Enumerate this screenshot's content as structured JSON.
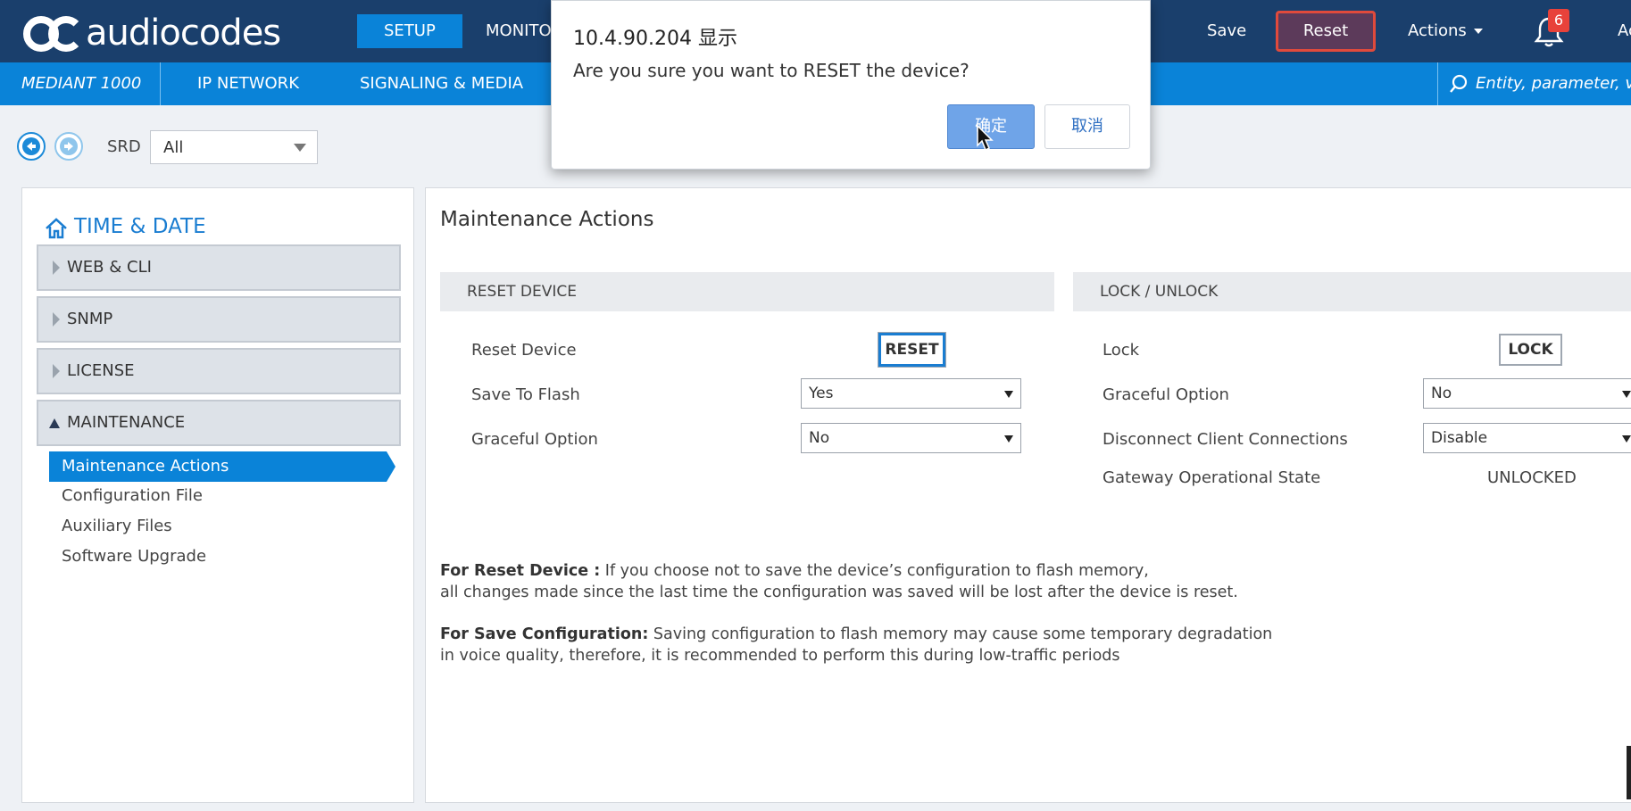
{
  "header": {
    "logo_text": "audiocodes",
    "tabs": [
      {
        "label": "SETUP",
        "active": true
      },
      {
        "label": "MONITOR",
        "active": false
      }
    ],
    "save_label": "Save",
    "reset_label": "Reset",
    "actions_label": "Actions",
    "notification_count": "6",
    "overflow_label": "Ac",
    "colors": {
      "bar": "#1a3f6c",
      "accent": "#0a83d8",
      "reset_bg": "#5c3a5a",
      "reset_border": "#e04a3c",
      "badge": "#e8423a"
    }
  },
  "subnav": {
    "device": "MEDIANT 1000",
    "items": [
      "IP NETWORK",
      "SIGNALING & MEDIA"
    ],
    "search_placeholder": "Entity, parameter, value"
  },
  "srd": {
    "label": "SRD",
    "value": "All"
  },
  "sidebar": {
    "title": "TIME & DATE",
    "sections": [
      {
        "label": "WEB & CLI",
        "expanded": false
      },
      {
        "label": "SNMP",
        "expanded": false
      },
      {
        "label": "LICENSE",
        "expanded": false
      },
      {
        "label": "MAINTENANCE",
        "expanded": true
      }
    ],
    "items": [
      {
        "label": "Maintenance Actions",
        "active": true
      },
      {
        "label": "Configuration File",
        "active": false
      },
      {
        "label": "Auxiliary Files",
        "active": false
      },
      {
        "label": "Software Upgrade",
        "active": false
      }
    ]
  },
  "main": {
    "title": "Maintenance Actions",
    "reset_section": {
      "header": "RESET DEVICE",
      "reset_device_label": "Reset Device",
      "reset_button": "RESET",
      "save_to_flash_label": "Save To Flash",
      "save_to_flash_value": "Yes",
      "graceful_label": "Graceful Option",
      "graceful_value": "No"
    },
    "lock_section": {
      "header": "LOCK / UNLOCK",
      "lock_label": "Lock",
      "lock_button": "LOCK",
      "graceful_label": "Graceful Option",
      "graceful_value": "No",
      "disconnect_label": "Disconnect Client Connections",
      "disconnect_value": "Disable",
      "state_label": "Gateway Operational State",
      "state_value": "UNLOCKED"
    },
    "notes": {
      "reset_bold": "For Reset Device :",
      "reset_line1": " If you choose not to save the device’s configuration to flash memory,",
      "reset_line2": "all changes made since the last time the configuration was saved will be lost after the device is reset.",
      "save_bold": "For Save Configuration:",
      "save_line1": " Saving configuration to flash memory may cause some temporary degradation",
      "save_line2": "in voice quality, therefore, it is recommended to perform this during low-traffic periods"
    }
  },
  "dialog": {
    "title": "10.4.90.204 显示",
    "message": "Are you sure you want to RESET the device?",
    "ok_label": "确定",
    "cancel_label": "取消"
  }
}
